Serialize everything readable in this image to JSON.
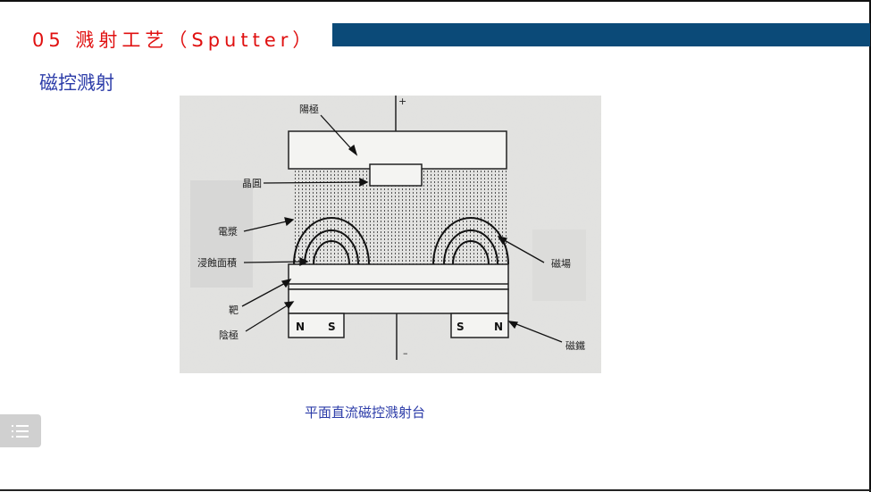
{
  "slide": {
    "title": "05 溅射工艺（Sputter）",
    "subtitle": "磁控溅射",
    "caption": "平面直流磁控溅射台"
  },
  "figure": {
    "labels": {
      "anode": "陽極",
      "wafer": "晶圓",
      "plasma": "電漿",
      "erosion_area": "浸蝕面積",
      "magnetic_field": "磁場",
      "target": "靶",
      "cathode": "陰極",
      "magnet": "磁鐵",
      "plus": "+",
      "minus": "–",
      "pole_n_left": "N",
      "pole_s_left": "S",
      "pole_s_right": "S",
      "pole_n_right": "N"
    }
  },
  "colors": {
    "title": "#e01010",
    "title_bar": "#0b4a78",
    "accent_text": "#2b3ba8"
  },
  "icons": {
    "menu": "list-menu-icon"
  }
}
